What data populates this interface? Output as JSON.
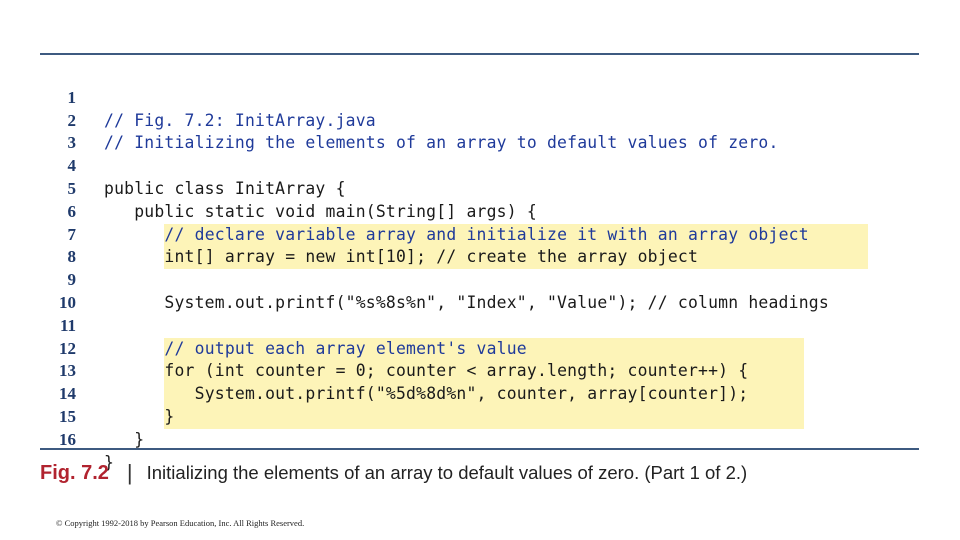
{
  "code_lines": [
    {
      "n": "1",
      "text": "// Fig. 7.2: InitArray.java"
    },
    {
      "n": "2",
      "text": "// Initializing the elements of an array to default values of zero."
    },
    {
      "n": "3",
      "text": ""
    },
    {
      "n": "4",
      "text": "public class InitArray {"
    },
    {
      "n": "5",
      "text": "   public static void main(String[] args) {"
    },
    {
      "n": "6",
      "text": "      // declare variable array and initialize it with an array object"
    },
    {
      "n": "7",
      "text": "      int[] array = new int[10]; // create the array object"
    },
    {
      "n": "8",
      "text": ""
    },
    {
      "n": "9",
      "text": "      System.out.printf(\"%s%8s%n\", \"Index\", \"Value\"); // column headings"
    },
    {
      "n": "10",
      "text": ""
    },
    {
      "n": "11",
      "text": "      // output each array element's value"
    },
    {
      "n": "12",
      "text": "      for (int counter = 0; counter < array.length; counter++) {"
    },
    {
      "n": "13",
      "text": "         System.out.printf(\"%5d%8d%n\", counter, array[counter]);"
    },
    {
      "n": "14",
      "text": "      }"
    },
    {
      "n": "15",
      "text": "   }"
    },
    {
      "n": "16",
      "text": "}"
    }
  ],
  "caption": {
    "label": "Fig. 7.2",
    "separator": "|",
    "text": "Initializing the elements of an array to default values of zero. (Part 1 of 2.)"
  },
  "copyright": "© Copyright 1992-2018 by Pearson Education, Inc. All Rights Reserved.",
  "colors": {
    "rule": "#3d5a80",
    "highlight": "#fdf4b8",
    "keyword": "#1f3a9a",
    "caption_label": "#b1232f"
  }
}
